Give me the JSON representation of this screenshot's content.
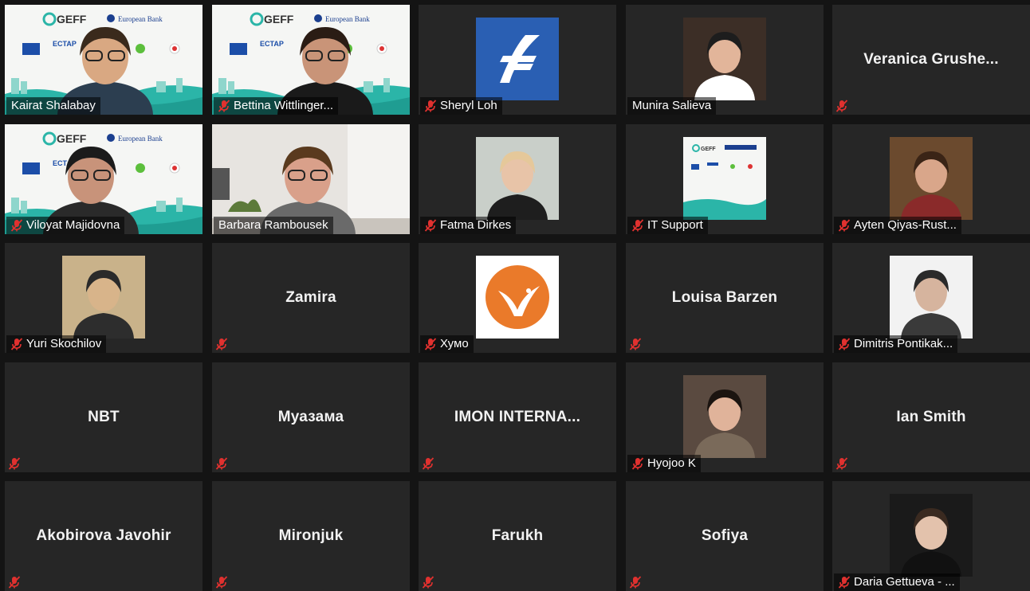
{
  "participants": [
    {
      "name": "Kairat Shalabay",
      "muted": false,
      "video": "slide-person"
    },
    {
      "name": "Bettina Wittlinger...",
      "muted": true,
      "video": "slide-person"
    },
    {
      "name": "Sheryl Loh",
      "muted": true,
      "video": "logo-blue"
    },
    {
      "name": "Munira Salieva",
      "muted": false,
      "video": "photo"
    },
    {
      "name": "Veranica  Grushe...",
      "muted": true,
      "video": "none"
    },
    {
      "name": "Viloyat Majidovna",
      "muted": true,
      "video": "slide-person"
    },
    {
      "name": "Barbara Rambousek",
      "muted": false,
      "video": "room-person"
    },
    {
      "name": "Fatma Dirkes",
      "muted": true,
      "video": "photo"
    },
    {
      "name": "IT Support",
      "muted": true,
      "video": "slide-thumb"
    },
    {
      "name": "Ayten Qiyas-Rust...",
      "muted": true,
      "video": "photo"
    },
    {
      "name": "Yuri Skochilov",
      "muted": true,
      "video": "photo"
    },
    {
      "name": "Zamira",
      "muted": true,
      "video": "none"
    },
    {
      "name": "Хумо",
      "muted": true,
      "video": "logo-orange"
    },
    {
      "name": "Louisa Barzen",
      "muted": true,
      "video": "none"
    },
    {
      "name": "Dimitris Pontikak...",
      "muted": true,
      "video": "photo"
    },
    {
      "name": "NBT",
      "muted": true,
      "video": "none"
    },
    {
      "name": "Муазама",
      "muted": true,
      "video": "none"
    },
    {
      "name": "IMON  INTERNA...",
      "muted": true,
      "video": "none"
    },
    {
      "name": "Hyojoo K",
      "muted": true,
      "video": "photo"
    },
    {
      "name": "Ian Smith",
      "muted": true,
      "video": "none"
    },
    {
      "name": "Akobirova Javohir",
      "muted": true,
      "video": "none"
    },
    {
      "name": "Mironjuk",
      "muted": true,
      "video": "none"
    },
    {
      "name": "Farukh",
      "muted": true,
      "video": "none"
    },
    {
      "name": "Sofiya",
      "muted": true,
      "video": "none"
    },
    {
      "name": "Daria Gettueva - ...",
      "muted": true,
      "video": "photo"
    }
  ],
  "slide": {
    "geff_logo": "GEFF",
    "bank_text": "European Bank",
    "ectap": "ECTAP"
  },
  "colors": {
    "background": "#141414",
    "tile": "#262626",
    "muted_icon": "#e0312f",
    "slide_teal": "#2bb5a8"
  }
}
